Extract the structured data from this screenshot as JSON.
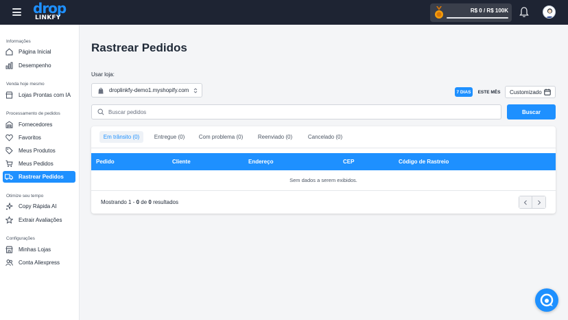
{
  "app": {
    "logo_top": "drop",
    "logo_bottom": "LINKFY",
    "goal_text": "R$ 0 / R$ 100K",
    "goal_progress": 0
  },
  "sidebar": {
    "sections": [
      {
        "title": "Informações",
        "items": [
          {
            "label": "Página Inicial",
            "icon": "home-icon"
          },
          {
            "label": "Desempenho",
            "icon": "bar-chart-icon"
          }
        ]
      },
      {
        "title": "Venda hoje mesmo",
        "items": [
          {
            "label": "Lojas Prontas com IA",
            "icon": "store-icon"
          }
        ]
      },
      {
        "title": "Processamento de pedidos",
        "items": [
          {
            "label": "Fornecedores",
            "icon": "warehouse-icon"
          },
          {
            "label": "Favoritos",
            "icon": "heart-icon"
          },
          {
            "label": "Meus Produtos",
            "icon": "tag-icon"
          },
          {
            "label": "Meus Pedidos",
            "icon": "cart-icon"
          },
          {
            "label": "Rastrear Pedidos",
            "icon": "truck-icon",
            "active": true
          }
        ]
      },
      {
        "title": "Otimize seu tempo",
        "items": [
          {
            "label": "Copy Rápida AI",
            "icon": "sparkles-icon"
          },
          {
            "label": "Extrair Avaliações",
            "icon": "star-icon"
          }
        ]
      },
      {
        "title": "Configurações",
        "items": [
          {
            "label": "Minhas Lojas",
            "icon": "store-icon"
          },
          {
            "label": "Conta Aliexpress",
            "icon": "users-icon"
          }
        ]
      }
    ]
  },
  "main": {
    "title": "Rastrear Pedidos",
    "store_label": "Usar loja:",
    "store_value": "droplinkfy-demo1.myshopify.com",
    "filters": {
      "days": "7 DIAS",
      "month": "ESTE MÊS",
      "custom": "Customizado"
    },
    "search_placeholder": "Buscar pedidos",
    "search_button": "Buscar",
    "tabs": [
      {
        "label": "Em trânsito (0)",
        "active": true
      },
      {
        "label": "Entregue (0)"
      },
      {
        "label": "Com problema (0)"
      },
      {
        "label": "Reenviado (0)"
      },
      {
        "label": "Cancelado (0)"
      }
    ],
    "columns": [
      "Pedido",
      "Cliente",
      "Endereço",
      "CEP",
      "Código de Rastreio"
    ],
    "empty_text": "Sem dados a serem exibidos.",
    "showing_prefix": "Mostrando ",
    "showing_from": "1",
    "showing_sep": " - ",
    "showing_to": "0",
    "showing_of": " de ",
    "showing_total": "0",
    "showing_suffix": " resultados"
  },
  "colors": {
    "primary": "#1e90ff",
    "topbar": "#1e2433"
  }
}
